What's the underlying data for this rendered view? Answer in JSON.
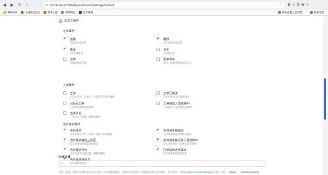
{
  "browser": {
    "url": "10.211.55.61:3000/devs/xemuvm/settings/hooks/3",
    "bookmarks": [
      "最常访问",
      "火狐官方站点",
      "新手上路",
      "常用网址",
      "京东商城"
    ],
    "bookmarks_right": [
      "移动设备上的书签",
      "其他书签"
    ]
  },
  "page": {
    "custom_events_label": "自定义事件...",
    "groups": {
      "repo": "仓库事件",
      "issue": "工单事件",
      "pr": "合并请求事件"
    },
    "repo_events": [
      {
        "label": "创建",
        "desc": "创建分支或标签",
        "checked": true
      },
      {
        "label": "删除",
        "desc": "分支或标签被删除",
        "checked": true
      },
      {
        "label": "推送",
        "desc": "Git 仓库推送",
        "checked": true
      },
      {
        "label": "派生",
        "desc": "仓库被派生",
        "checked": false
      },
      {
        "label": "仓库",
        "desc": "创建或删除仓库",
        "checked": false
      },
      {
        "label": "版本发布",
        "desc": "发布、更新或删除版本发布",
        "checked": false
      }
    ],
    "issue_events": [
      {
        "label": "工单",
        "desc": "工单已打开、已关闭、已重新打开或已编辑",
        "checked": false
      },
      {
        "label": "工单已指派",
        "desc": "工单已指派或已取消指派",
        "checked": false
      },
      {
        "label": "已标记工单",
        "desc": "工单标签被更新或删除",
        "checked": false
      },
      {
        "label": "工单被加入里程碑中",
        "desc": "工单被加入或移除出里程碑",
        "checked": false
      },
      {
        "label": "工单评论",
        "desc": "工单评论已创建、编辑或删除",
        "checked": false
      }
    ],
    "pr_events": [
      {
        "label": "合并请求",
        "desc": "合并请求已打开、关闭、重新打开或编辑",
        "checked": true
      },
      {
        "label": "合并请求被指派",
        "desc": "合并请求被指派或取消指派",
        "checked": true
      },
      {
        "label": "合并请求被贴上标签",
        "desc": "合并请求标签被更新或删除",
        "checked": true
      },
      {
        "label": "合并请求被记录于里程碑中",
        "desc": "合并请求被加入或移除出里程碑",
        "checked": true
      },
      {
        "label": "合并请求评论",
        "desc": "合并请求评论被创建、编辑或删除",
        "checked": true
      },
      {
        "label": "已审核的合并请求",
        "desc": "合并请求被批准或拒绝",
        "checked": true
      },
      {
        "label": "合并请求被同步",
        "desc": "合并请求被同步",
        "checked": true
      }
    ],
    "branch_filter_label": "分支过滤",
    "branch_filter_value": "*",
    "help_prefix": "匹配、推送、删除分支事件的分支白名单，作为通配符模式，如果为空或包含",
    "help_code": "*",
    "help_mid": "则报告所有分支的事件。有关语法，请参阅",
    "help_link": "github.com/gobwas/glob",
    "help_suffix": "文档。示例：",
    "help_code2": "master",
    "help_or": "，",
    "help_code3": "{master,release*}"
  }
}
